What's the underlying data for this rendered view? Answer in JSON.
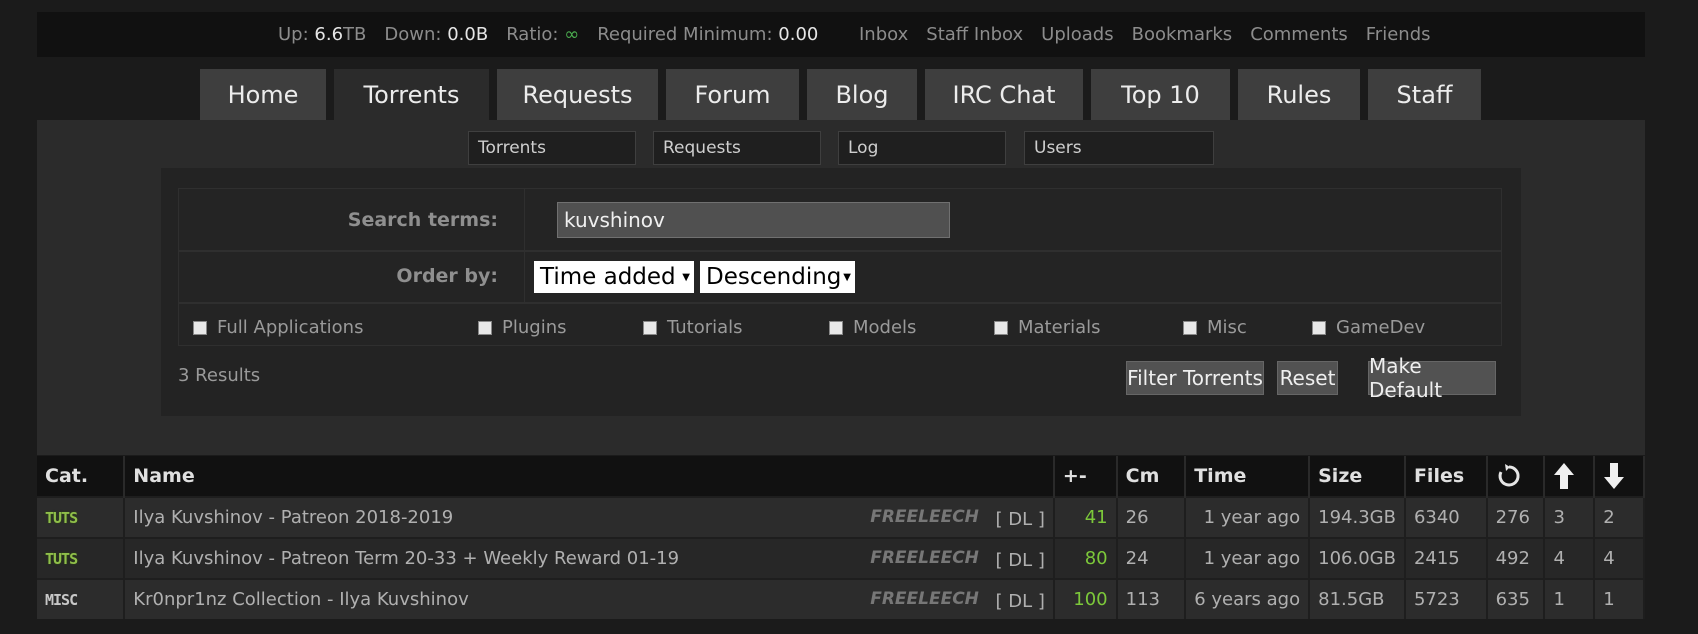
{
  "stats": {
    "up_label": "Up:",
    "up_value": "6.6",
    "up_unit": "TB",
    "down_label": "Down:",
    "down_value": "0.0B",
    "ratio_label": "Ratio:",
    "ratio_value": "∞",
    "req_label": "Required Minimum:",
    "req_value": "0.00"
  },
  "usernav": [
    "Inbox",
    "Staff Inbox",
    "Uploads",
    "Bookmarks",
    "Comments",
    "Friends"
  ],
  "tabs": [
    "Home",
    "Torrents",
    "Requests",
    "Forum",
    "Blog",
    "IRC Chat",
    "Top 10",
    "Rules",
    "Staff"
  ],
  "subnav": [
    "Torrents",
    "Requests",
    "Log",
    "Users"
  ],
  "search": {
    "terms_label": "Search terms:",
    "terms_value": "kuvshinov",
    "order_label": "Order by:",
    "order_field": "Time added",
    "order_dir": "Descending",
    "categories": [
      "Full Applications",
      "Plugins",
      "Tutorials",
      "Models",
      "Materials",
      "Misc",
      "GameDev"
    ],
    "results": "3 Results",
    "filter_btn": "Filter Torrents",
    "reset_btn": "Reset",
    "default_btn": "Make Default"
  },
  "table": {
    "headers": {
      "cat": "Cat.",
      "name": "Name",
      "pm": "+-",
      "cm": "Cm",
      "time": "Time",
      "size": "Size",
      "files": "Files"
    },
    "rows": [
      {
        "cat": "TUTS",
        "cat_color": "#8fbf4a",
        "name": "Ilya Kuvshinov - Patreon 2018-2019",
        "free": "FREELEECH",
        "dl": "[ DL ]",
        "pm": "41",
        "cm": "26",
        "time": "1 year ago",
        "size": "194.3GB",
        "files": "6340",
        "snatched": "276",
        "seeders": "3",
        "leechers": "2"
      },
      {
        "cat": "TUTS",
        "cat_color": "#8fbf4a",
        "name": "Ilya Kuvshinov - Patreon Term 20-33 + Weekly Reward 01-19",
        "free": "FREELEECH",
        "dl": "[ DL ]",
        "pm": "80",
        "cm": "24",
        "time": "1 year ago",
        "size": "106.0GB",
        "files": "2415",
        "snatched": "492",
        "seeders": "4",
        "leechers": "4"
      },
      {
        "cat": "MISC",
        "cat_color": "#c8c8c8",
        "name": "Kr0npr1nz Collection - Ilya Kuvshinov",
        "free": "FREELEECH",
        "dl": "[ DL ]",
        "pm": "100",
        "cm": "113",
        "time": "6 years ago",
        "size": "81.5GB",
        "files": "5723",
        "snatched": "635",
        "seeders": "1",
        "leechers": "1"
      }
    ]
  }
}
